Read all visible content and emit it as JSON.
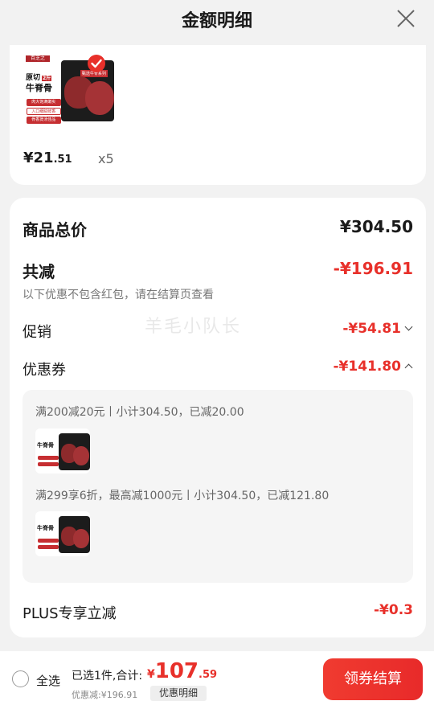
{
  "header": {
    "title": "金额明细",
    "close_icon": "close-icon"
  },
  "product": {
    "thumb_text": {
      "brand": "百芝之",
      "line1": "原切",
      "tag": "2斤",
      "line2": "牛脊骨",
      "band1": "肉大饱满嫩实",
      "band2": "入口细腻鲜香",
      "band3": "骨香煲汤佳品",
      "box": "甄选牛脊系列"
    },
    "price_int": "¥21",
    "price_dec": ".51",
    "qty": "x5",
    "selected_icon": "check-circle-icon"
  },
  "summary": {
    "total_label": "商品总价",
    "total_value": "¥304.50",
    "reduce_label": "共减",
    "reduce_value": "-¥196.91",
    "note": "以下优惠不包含红包，请在结算页查看",
    "promo_label": "促销",
    "promo_value": "-¥54.81",
    "coupon_label": "优惠券",
    "coupon_value": "-¥141.80",
    "coupons": [
      {
        "text": "满200减20元丨小计304.50，已减20.00"
      },
      {
        "text": "满299享6折，最高减1000元丨小计304.50，已减121.80"
      }
    ],
    "plus_label": "PLUS专享立减",
    "plus_value": "-¥0.3"
  },
  "watermark": "羊毛小队长",
  "footer": {
    "select_all": "全选",
    "selected_text": "已选1件,合计:",
    "total_sym": "¥",
    "total_int": "107",
    "total_dec": ".59",
    "discount_text": "优惠减:¥196.91",
    "detail_btn": "优惠明细",
    "checkout_btn": "领券结算"
  },
  "colors": {
    "accent": "#e8302a",
    "background": "#f2f2f2"
  }
}
